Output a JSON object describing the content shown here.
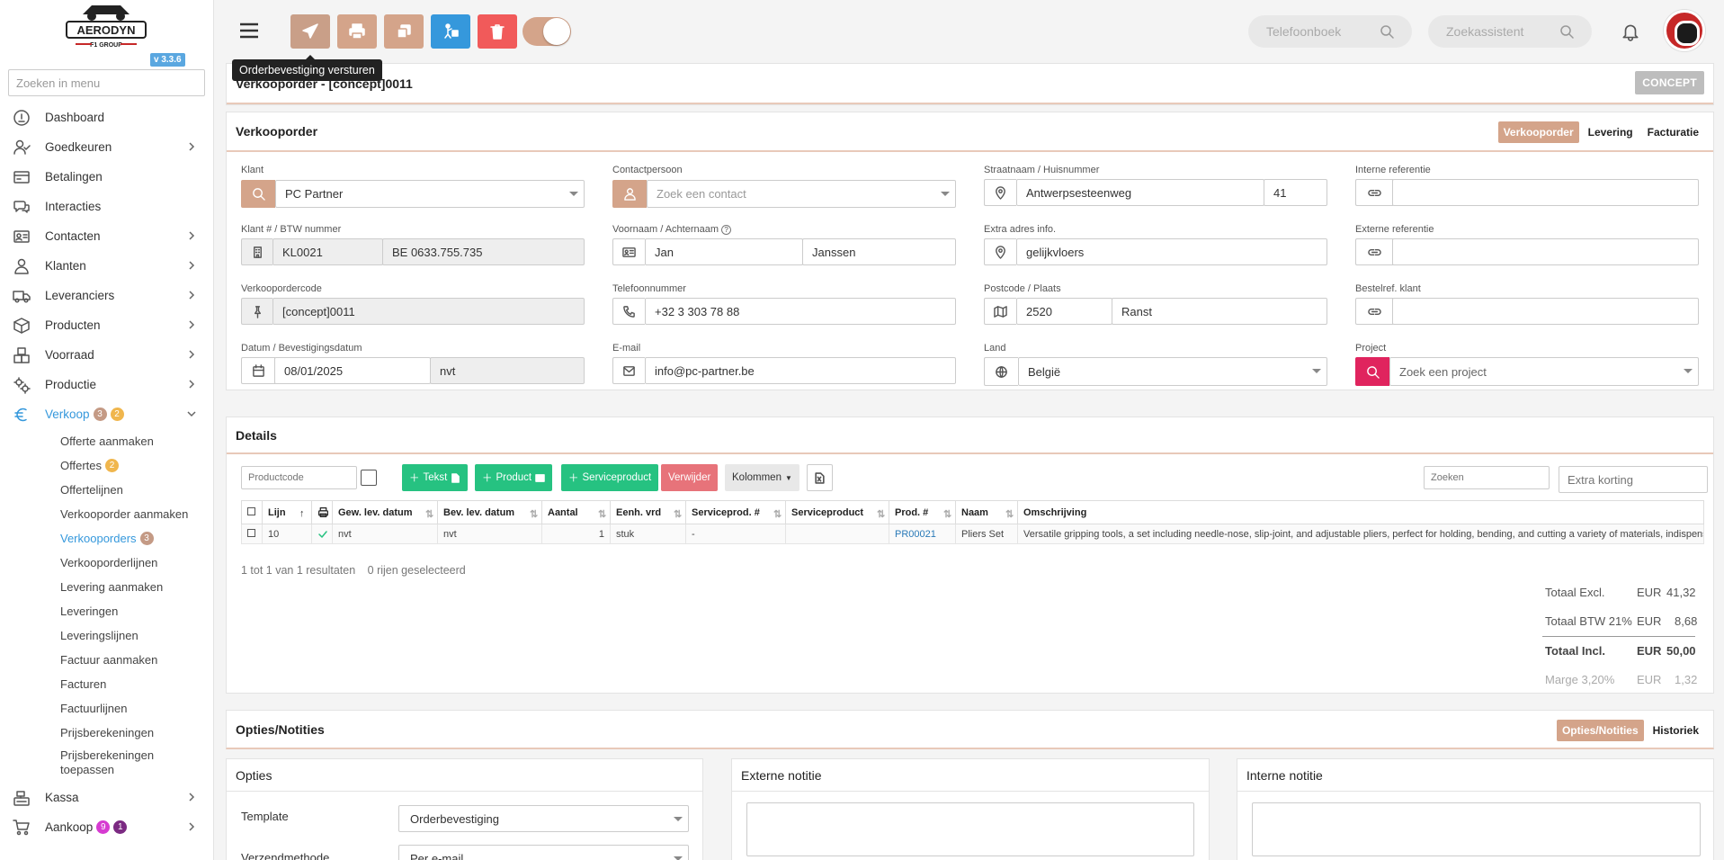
{
  "sidebar": {
    "version": "v 3.3.6",
    "search_placeholder": "Zoeken in menu",
    "items": [
      {
        "label": "Dashboard"
      },
      {
        "label": "Goedkeuren"
      },
      {
        "label": "Betalingen"
      },
      {
        "label": "Interacties"
      },
      {
        "label": "Contacten"
      },
      {
        "label": "Klanten"
      },
      {
        "label": "Leveranciers"
      },
      {
        "label": "Producten"
      },
      {
        "label": "Voorraad"
      },
      {
        "label": "Productie"
      },
      {
        "label": "Verkoop",
        "badge1": "3",
        "badge2": "2"
      },
      {
        "label": "Kassa"
      },
      {
        "label": "Aankoop",
        "badge1": "9",
        "badge2": "1"
      }
    ],
    "verkoop_sub": [
      {
        "label": "Offerte aanmaken"
      },
      {
        "label": "Offertes",
        "badge": "2"
      },
      {
        "label": "Offertelijnen"
      },
      {
        "label": "Verkooporder aanmaken"
      },
      {
        "label": "Verkooporders",
        "badge": "3"
      },
      {
        "label": "Verkooporderlijnen"
      },
      {
        "label": "Levering aanmaken"
      },
      {
        "label": "Leveringen"
      },
      {
        "label": "Leveringslijnen"
      },
      {
        "label": "Factuur aanmaken"
      },
      {
        "label": "Facturen"
      },
      {
        "label": "Factuurlijnen"
      },
      {
        "label": "Prijsberekeningen"
      },
      {
        "label": "Prijsberekeningen toepassen"
      }
    ]
  },
  "topbar": {
    "tooltip": "Orderbevestiging versturen",
    "phonebook_placeholder": "Telefoonboek",
    "assistant_placeholder": "Zoekassistent"
  },
  "header": {
    "title": "Verkooporder - [concept]0011",
    "status": "CONCEPT"
  },
  "order": {
    "section_title": "Verkooporder",
    "tabs": [
      "Verkooporder",
      "Levering",
      "Facturatie"
    ],
    "fields": {
      "klant_label": "Klant",
      "klant": "PC Partner",
      "contact_label": "Contactpersoon",
      "contact_placeholder": "Zoek een contact",
      "straat_label": "Straatnaam / Huisnummer",
      "straat": "Antwerpsesteenweg",
      "huisnummer": "41",
      "intref_label": "Interne referentie",
      "klantnr_label": "Klant # / BTW nummer",
      "klantnr": "KL0021",
      "btw": "BE 0633.755.735",
      "naam_label": "Voornaam / Achternaam",
      "voornaam": "Jan",
      "achternaam": "Janssen",
      "extra_label": "Extra adres info.",
      "extra": "gelijkvloers",
      "extref_label": "Externe referentie",
      "code_label": "Verkoopordercode",
      "code": "[concept]0011",
      "tel_label": "Telefoonnummer",
      "tel": "+32 3 303 78 88",
      "postcode_label": "Postcode / Plaats",
      "postcode": "2520",
      "plaats": "Ranst",
      "bestelref_label": "Bestelref. klant",
      "datum_label": "Datum / Bevestigingsdatum",
      "datum": "08/01/2025",
      "bevestiging": "nvt",
      "email_label": "E-mail",
      "email": "info@pc-partner.be",
      "land_label": "Land",
      "land": "België",
      "project_label": "Project",
      "project_placeholder": "Zoek een project"
    }
  },
  "details": {
    "title": "Details",
    "productcode_placeholder": "Productcode",
    "btn_tekst": "Tekst",
    "btn_product": "Product",
    "btn_service": "Serviceproduct",
    "btn_remove": "Verwijder",
    "btn_columns": "Kolommen",
    "search_placeholder": "Zoeken",
    "discount_placeholder": "Extra korting",
    "columns": [
      "Lijn",
      "Gew. lev. datum",
      "Bev. lev. datum",
      "Aantal",
      "Eenh. vrd",
      "Serviceprod. #",
      "Serviceproduct",
      "Prod. #",
      "Naam",
      "Omschrijving"
    ],
    "rows": [
      {
        "lijn": "10",
        "gew": "nvt",
        "bev": "nvt",
        "aantal": "1",
        "eenh": "stuk",
        "sprodnr": "-",
        "sprod": "",
        "prodnr": "PR00021",
        "naam": "Pliers Set",
        "omschrijving": "Versatile gripping tools, a set including needle-nose, slip-joint, and adjustable pliers, perfect for holding, bending, and cutting a variety of materials, indispens"
      }
    ],
    "result_text": "1 tot 1 van 1 resultaten",
    "selected_text": "0 rijen geselecteerd",
    "totals": [
      {
        "label": "Totaal Excl.",
        "cur": "EUR",
        "value": "41,32"
      },
      {
        "label": "Totaal BTW 21%",
        "cur": "EUR",
        "value": "8,68"
      },
      {
        "label": "Totaal Incl.",
        "cur": "EUR",
        "value": "50,00"
      },
      {
        "label": "Marge 3,20%",
        "cur": "EUR",
        "value": "1,32"
      }
    ]
  },
  "notes": {
    "title": "Opties/Notities",
    "tabs": [
      "Opties/Notities",
      "Historiek"
    ],
    "opties_title": "Opties",
    "template_label": "Template",
    "template_value": "Orderbevestiging",
    "verzend_label": "Verzendmethode",
    "verzend_value": "Per e-mail",
    "extern_title": "Externe notitie",
    "intern_title": "Interne notitie"
  },
  "colors": {
    "accent": "#d4a48a",
    "primary": "#3598dc",
    "green": "#26c281",
    "danger": "#f15a5a"
  }
}
